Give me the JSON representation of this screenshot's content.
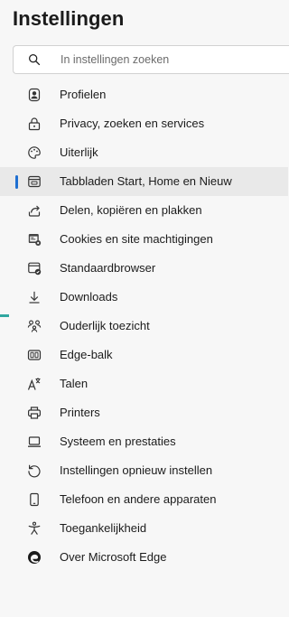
{
  "window": {
    "title": "Instellingen"
  },
  "search": {
    "placeholder": "In instellingen zoeken",
    "value": "",
    "icon": "search-icon"
  },
  "menu": {
    "items": [
      {
        "label": "Profielen",
        "icon": "profile-icon",
        "selected": false
      },
      {
        "label": "Privacy, zoeken en services",
        "icon": "lock-icon",
        "selected": false
      },
      {
        "label": "Uiterlijk",
        "icon": "appearance-icon",
        "selected": false
      },
      {
        "label": "Tabbladen Start, Home en Nieuw",
        "icon": "tabs-icon",
        "selected": true
      },
      {
        "label": "Delen, kopiëren en plakken",
        "icon": "share-icon",
        "selected": false
      },
      {
        "label": "Cookies en site machtigingen",
        "icon": "cookies-icon",
        "selected": false
      },
      {
        "label": "Standaardbrowser",
        "icon": "browser-icon",
        "selected": false
      },
      {
        "label": "Downloads",
        "icon": "download-icon",
        "selected": false
      },
      {
        "label": "Ouderlijk toezicht",
        "icon": "family-icon",
        "selected": false
      },
      {
        "label": "Edge-balk",
        "icon": "edge-bar-icon",
        "selected": false
      },
      {
        "label": "Talen",
        "icon": "languages-icon",
        "selected": false
      },
      {
        "label": "Printers",
        "icon": "printer-icon",
        "selected": false
      },
      {
        "label": "Systeem en prestaties",
        "icon": "laptop-icon",
        "selected": false
      },
      {
        "label": "Instellingen opnieuw instellen",
        "icon": "reset-icon",
        "selected": false
      },
      {
        "label": "Telefoon en andere apparaten",
        "icon": "phone-icon",
        "selected": false
      },
      {
        "label": "Toegankelijkheid",
        "icon": "accessibility-icon",
        "selected": false
      },
      {
        "label": "Over Microsoft Edge",
        "icon": "edge-logo-icon",
        "selected": false
      }
    ]
  },
  "colors": {
    "background": "#f7f7f7",
    "selected_background": "#e9e9e9",
    "accent": "#1f6fd1",
    "text": "#1b1b1b"
  }
}
